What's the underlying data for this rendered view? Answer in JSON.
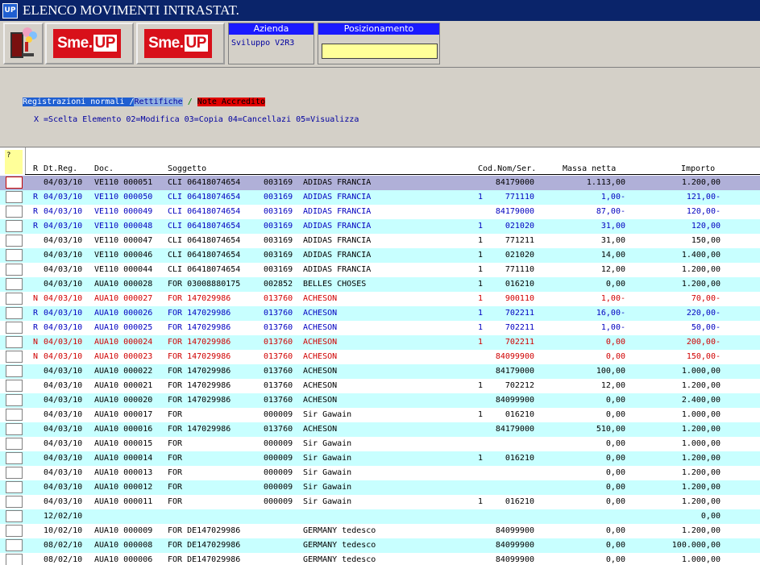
{
  "window": {
    "title": "ELENCO MOVIMENTI INTRASTAT.",
    "app_icon": "UP"
  },
  "toolbar": {
    "logo1": {
      "pre": "Sme.",
      "post": "UP"
    },
    "logo2": {
      "pre": "Sme.",
      "post": "UP"
    },
    "azienda_label": "Azienda",
    "azienda_value": "Sviluppo V2R3",
    "posizionamento_label": "Posizionamento",
    "posizionamento_value": ""
  },
  "legend": {
    "normal": "Registrazioni normali /",
    "rettifiche": "Rettifiche",
    "sep": "/",
    "note": "Note Accredito"
  },
  "options_line": "X =Scelta Elemento 02=Modifica 03=Copia 04=Cancellazi 05=Visualizza",
  "grid": {
    "corner_label": "?",
    "columns": {
      "r": "R",
      "dt": "Dt.Reg.",
      "doc": "Doc.",
      "soggetto": "Soggetto",
      "cod": "Cod.Nom/Ser.",
      "massa": "Massa netta",
      "importo": "Importo"
    },
    "rows": [
      {
        "t": "n",
        "r": "",
        "dt": "04/03/10",
        "doc": "VE110 000051",
        "sog": "CLI 06418074654",
        "cod_s": "003169",
        "name": "ADIDAS FRANCIA",
        "g": "",
        "nom": "84179000",
        "massa": "1.113,00",
        "imp": "1.200,00"
      },
      {
        "t": "r",
        "r": "R",
        "dt": "04/03/10",
        "doc": "VE110 000050",
        "sog": "CLI 06418074654",
        "cod_s": "003169",
        "name": "ADIDAS FRANCIA",
        "g": "1",
        "nom": "771110",
        "massa": "1,00-",
        "imp": "121,00-"
      },
      {
        "t": "r",
        "r": "R",
        "dt": "04/03/10",
        "doc": "VE110 000049",
        "sog": "CLI 06418074654",
        "cod_s": "003169",
        "name": "ADIDAS FRANCIA",
        "g": "",
        "nom": "84179000",
        "massa": "87,00-",
        "imp": "120,00-"
      },
      {
        "t": "r",
        "r": "R",
        "dt": "04/03/10",
        "doc": "VE110 000048",
        "sog": "CLI 06418074654",
        "cod_s": "003169",
        "name": "ADIDAS FRANCIA",
        "g": "1",
        "nom": "021020",
        "massa": "31,00",
        "imp": "120,00"
      },
      {
        "t": "n",
        "r": "",
        "dt": "04/03/10",
        "doc": "VE110 000047",
        "sog": "CLI 06418074654",
        "cod_s": "003169",
        "name": "ADIDAS FRANCIA",
        "g": "1",
        "nom": "771211",
        "massa": "31,00",
        "imp": "150,00"
      },
      {
        "t": "n",
        "r": "",
        "dt": "04/03/10",
        "doc": "VE110 000046",
        "sog": "CLI 06418074654",
        "cod_s": "003169",
        "name": "ADIDAS FRANCIA",
        "g": "1",
        "nom": "021020",
        "massa": "14,00",
        "imp": "1.400,00"
      },
      {
        "t": "n",
        "r": "",
        "dt": "04/03/10",
        "doc": "VE110 000044",
        "sog": "CLI 06418074654",
        "cod_s": "003169",
        "name": "ADIDAS FRANCIA",
        "g": "1",
        "nom": "771110",
        "massa": "12,00",
        "imp": "1.200,00"
      },
      {
        "t": "n",
        "r": "",
        "dt": "04/03/10",
        "doc": "AUA10 000028",
        "sog": "FOR 03008880175",
        "cod_s": "002852",
        "name": "BELLES CHOSES",
        "g": "1",
        "nom": "016210",
        "massa": "0,00",
        "imp": "1.200,00"
      },
      {
        "t": "c",
        "r": "N",
        "dt": "04/03/10",
        "doc": "AUA10 000027",
        "sog": "FOR 147029986",
        "cod_s": "013760",
        "name": "ACHESON",
        "g": "1",
        "nom": "900110",
        "massa": "1,00-",
        "imp": "70,00-"
      },
      {
        "t": "r",
        "r": "R",
        "dt": "04/03/10",
        "doc": "AUA10 000026",
        "sog": "FOR 147029986",
        "cod_s": "013760",
        "name": "ACHESON",
        "g": "1",
        "nom": "702211",
        "massa": "16,00-",
        "imp": "220,00-"
      },
      {
        "t": "r",
        "r": "R",
        "dt": "04/03/10",
        "doc": "AUA10 000025",
        "sog": "FOR 147029986",
        "cod_s": "013760",
        "name": "ACHESON",
        "g": "1",
        "nom": "702211",
        "massa": "1,00-",
        "imp": "50,00-"
      },
      {
        "t": "c",
        "r": "N",
        "dt": "04/03/10",
        "doc": "AUA10 000024",
        "sog": "FOR 147029986",
        "cod_s": "013760",
        "name": "ACHESON",
        "g": "1",
        "nom": "702211",
        "massa": "0,00",
        "imp": "200,00-"
      },
      {
        "t": "c",
        "r": "N",
        "dt": "04/03/10",
        "doc": "AUA10 000023",
        "sog": "FOR 147029986",
        "cod_s": "013760",
        "name": "ACHESON",
        "g": "",
        "nom": "84099900",
        "massa": "0,00",
        "imp": "150,00-"
      },
      {
        "t": "n",
        "r": "",
        "dt": "04/03/10",
        "doc": "AUA10 000022",
        "sog": "FOR 147029986",
        "cod_s": "013760",
        "name": "ACHESON",
        "g": "",
        "nom": "84179000",
        "massa": "100,00",
        "imp": "1.000,00"
      },
      {
        "t": "n",
        "r": "",
        "dt": "04/03/10",
        "doc": "AUA10 000021",
        "sog": "FOR 147029986",
        "cod_s": "013760",
        "name": "ACHESON",
        "g": "1",
        "nom": "702212",
        "massa": "12,00",
        "imp": "1.200,00"
      },
      {
        "t": "n",
        "r": "",
        "dt": "04/03/10",
        "doc": "AUA10 000020",
        "sog": "FOR 147029986",
        "cod_s": "013760",
        "name": "ACHESON",
        "g": "",
        "nom": "84099900",
        "massa": "0,00",
        "imp": "2.400,00"
      },
      {
        "t": "n",
        "r": "",
        "dt": "04/03/10",
        "doc": "AUA10 000017",
        "sog": "FOR",
        "cod_s": "000009",
        "name": "Sir Gawain",
        "g": "1",
        "nom": "016210",
        "massa": "0,00",
        "imp": "1.000,00"
      },
      {
        "t": "n",
        "r": "",
        "dt": "04/03/10",
        "doc": "AUA10 000016",
        "sog": "FOR 147029986",
        "cod_s": "013760",
        "name": "ACHESON",
        "g": "",
        "nom": "84179000",
        "massa": "510,00",
        "imp": "1.200,00"
      },
      {
        "t": "n",
        "r": "",
        "dt": "04/03/10",
        "doc": "AUA10 000015",
        "sog": "FOR",
        "cod_s": "000009",
        "name": "Sir Gawain",
        "g": "",
        "nom": "",
        "massa": "0,00",
        "imp": "1.000,00"
      },
      {
        "t": "n",
        "r": "",
        "dt": "04/03/10",
        "doc": "AUA10 000014",
        "sog": "FOR",
        "cod_s": "000009",
        "name": "Sir Gawain",
        "g": "1",
        "nom": "016210",
        "massa": "0,00",
        "imp": "1.200,00"
      },
      {
        "t": "n",
        "r": "",
        "dt": "04/03/10",
        "doc": "AUA10 000013",
        "sog": "FOR",
        "cod_s": "000009",
        "name": "Sir Gawain",
        "g": "",
        "nom": "",
        "massa": "0,00",
        "imp": "1.200,00"
      },
      {
        "t": "n",
        "r": "",
        "dt": "04/03/10",
        "doc": "AUA10 000012",
        "sog": "FOR",
        "cod_s": "000009",
        "name": "Sir Gawain",
        "g": "",
        "nom": "",
        "massa": "0,00",
        "imp": "1.200,00"
      },
      {
        "t": "n",
        "r": "",
        "dt": "04/03/10",
        "doc": "AUA10 000011",
        "sog": "FOR",
        "cod_s": "000009",
        "name": "Sir Gawain",
        "g": "1",
        "nom": "016210",
        "massa": "0,00",
        "imp": "1.200,00"
      },
      {
        "t": "n",
        "r": "",
        "dt": "12/02/10",
        "doc": "",
        "sog": "",
        "cod_s": "",
        "name": "",
        "g": "",
        "nom": "",
        "massa": "",
        "imp": "0,00"
      },
      {
        "t": "n",
        "r": "",
        "dt": "10/02/10",
        "doc": "AUA10 000009",
        "sog": "FOR DE147029986",
        "cod_s": "",
        "name": "GERMANY tedesco",
        "g": "",
        "nom": "84099900",
        "massa": "0,00",
        "imp": "1.200,00"
      },
      {
        "t": "n",
        "r": "",
        "dt": "08/02/10",
        "doc": "AUA10 000008",
        "sog": "FOR DE147029986",
        "cod_s": "",
        "name": "GERMANY tedesco",
        "g": "",
        "nom": "84099900",
        "massa": "0,00",
        "imp": "100.000,00"
      },
      {
        "t": "n",
        "r": "",
        "dt": "08/02/10",
        "doc": "AUA10 000006",
        "sog": "FOR DE147029986",
        "cod_s": "",
        "name": "GERMANY tedesco",
        "g": "",
        "nom": "84099900",
        "massa": "0,00",
        "imp": "1.000,00"
      }
    ]
  }
}
